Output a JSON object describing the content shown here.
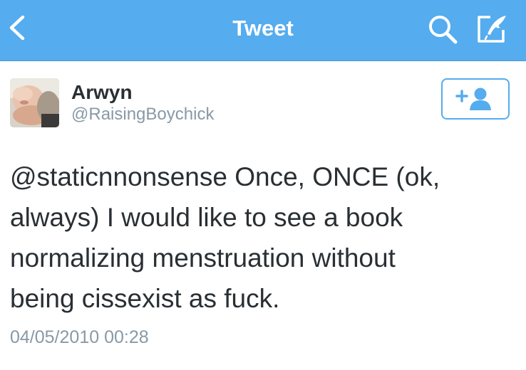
{
  "navbar": {
    "title": "Tweet",
    "back_icon": "chevron-left-icon",
    "search_icon": "search-icon",
    "compose_icon": "compose-icon",
    "background_color": "#55acee"
  },
  "tweet": {
    "author": {
      "name": "Arwyn",
      "handle": "@RaisingBoychick"
    },
    "follow_button_icon": "add-user-icon",
    "text": "@staticnnonsense Once, ONCE (ok, always) I would like to see a book normalizing menstruation without being cissexist as fuck.",
    "lines": [
      "@staticnnonsense Once, ONCE (ok,",
      "always) I would like to see a book",
      "normalizing menstruation without",
      "being cissexist as fuck."
    ],
    "timestamp": "04/05/2010 00:28"
  },
  "colors": {
    "accent": "#55acee",
    "text": "#292f33",
    "secondary_text": "#8899a6"
  }
}
